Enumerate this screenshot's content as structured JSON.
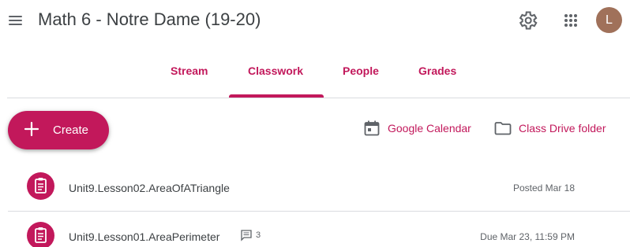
{
  "theme": {
    "accent": "#c2185b",
    "avatar_color": "#a0715a",
    "icon_gray": "#5f6368"
  },
  "header": {
    "title": "Math 6 - Notre Dame (19-20)",
    "avatar_letter": "L"
  },
  "tabs": [
    {
      "label": "Stream",
      "active": false
    },
    {
      "label": "Classwork",
      "active": true
    },
    {
      "label": "People",
      "active": false
    },
    {
      "label": "Grades",
      "active": false
    }
  ],
  "toolbar": {
    "create_label": "Create",
    "calendar_label": "Google Calendar",
    "drive_label": "Class Drive folder"
  },
  "items": [
    {
      "title": "Unit9.Lesson02.AreaOfATriangle",
      "meta": "Posted Mar 18",
      "comments": ""
    },
    {
      "title": "Unit9.Lesson01.AreaPerimeter",
      "meta": "Due Mar 23, 11:59 PM",
      "comments": "3"
    }
  ]
}
